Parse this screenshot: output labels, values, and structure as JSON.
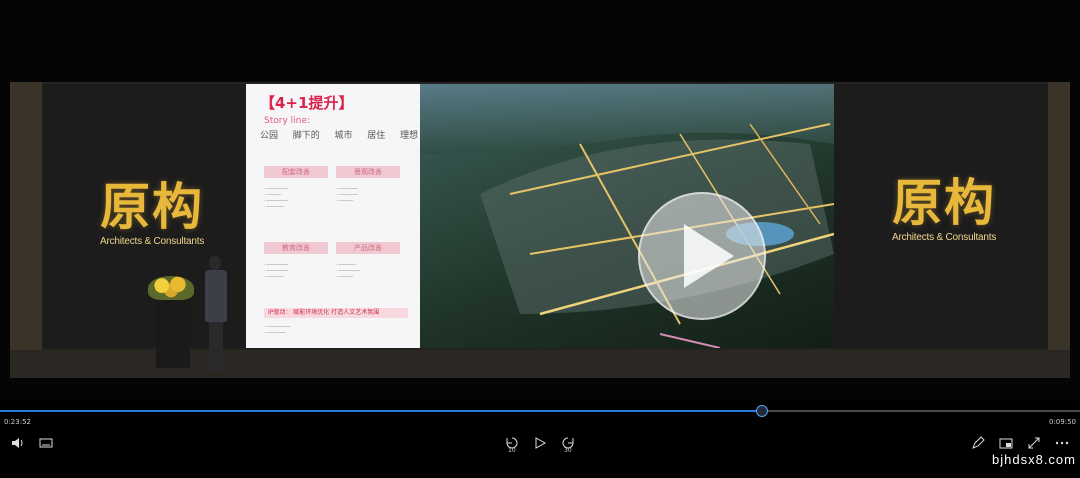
{
  "logo": {
    "mark": "原构",
    "subtitle": "Architects & Consultants"
  },
  "slide": {
    "title": "【4+1提升】",
    "story_label": "Story line:",
    "story_items": [
      "公园",
      "脚下的",
      "城市",
      "居住",
      "理想"
    ],
    "sections": [
      "配套改善",
      "景观改善",
      "教育改善",
      "产品改善"
    ],
    "ip_bar": "IP驱动：  赋能环境优化   打造人文艺术氛围"
  },
  "player": {
    "progress": 0.706,
    "time_current": "0:23:52",
    "time_total": "0:09:50",
    "icons": [
      "volume-icon",
      "subtitles-icon",
      "rewind-10-icon",
      "play-icon",
      "forward-30-icon",
      "pen-icon",
      "miniplayer-icon",
      "fullscreen-icon",
      "more-icon"
    ],
    "rewind_label": "10",
    "forward_label": "30",
    "accent": "#2a7ad5"
  },
  "watermark": "bjhdsx8.com"
}
